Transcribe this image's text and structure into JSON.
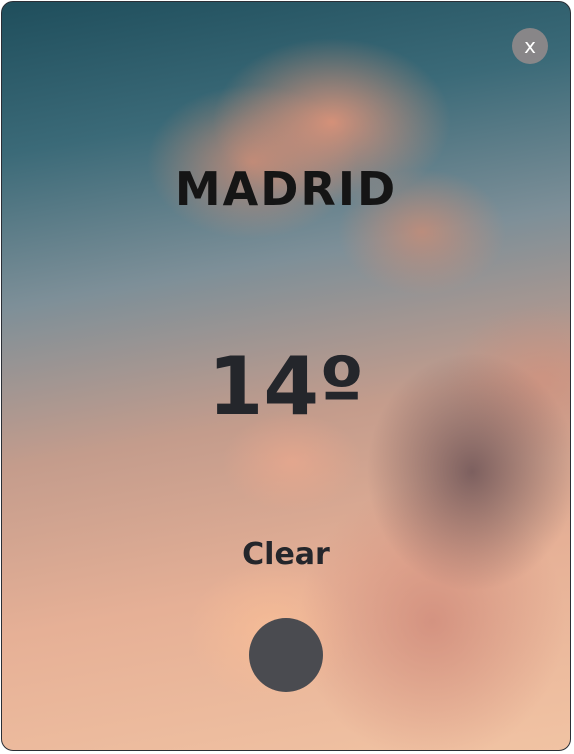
{
  "header": {
    "close_label": "x"
  },
  "weather": {
    "city": "MADRID",
    "temperature": "14º",
    "condition": "Clear",
    "icon": "weather-status-icon"
  }
}
